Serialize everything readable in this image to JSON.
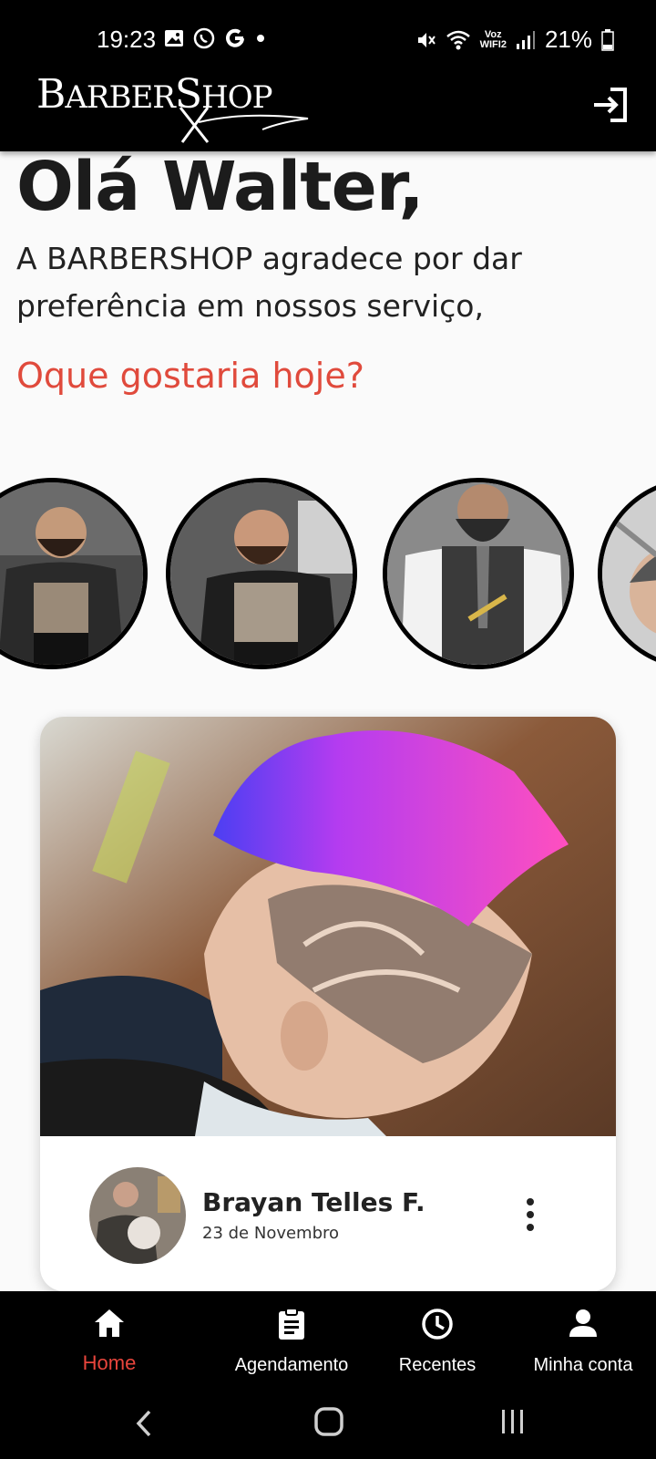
{
  "status_bar": {
    "time": "19:23",
    "battery": "21%",
    "network_label_top": "Voz",
    "network_label_bottom": "WIFI2"
  },
  "app_bar": {
    "logo_text_big_b": "B",
    "logo_text_arber": "ARBER",
    "logo_text_big_s": "S",
    "logo_text_hop": "HOP"
  },
  "content": {
    "greeting": "Olá Walter,",
    "subtext": "A BARBERSHOP agradece por dar preferência em nossos serviço,",
    "question": "Oque gostaria hoje?"
  },
  "post": {
    "author": "Brayan Telles F.",
    "date": "23 de Novembro"
  },
  "bottom_nav": {
    "items": [
      {
        "label": "Home",
        "icon": "home-icon",
        "active": true
      },
      {
        "label": "Agendamento",
        "icon": "clipboard-icon",
        "active": false
      },
      {
        "label": "Recentes",
        "icon": "clock-icon",
        "active": false
      },
      {
        "label": "Minha conta",
        "icon": "person-icon",
        "active": false
      }
    ]
  },
  "colors": {
    "accent": "#e8453c",
    "bar": "#000000",
    "background": "#fafafa"
  }
}
